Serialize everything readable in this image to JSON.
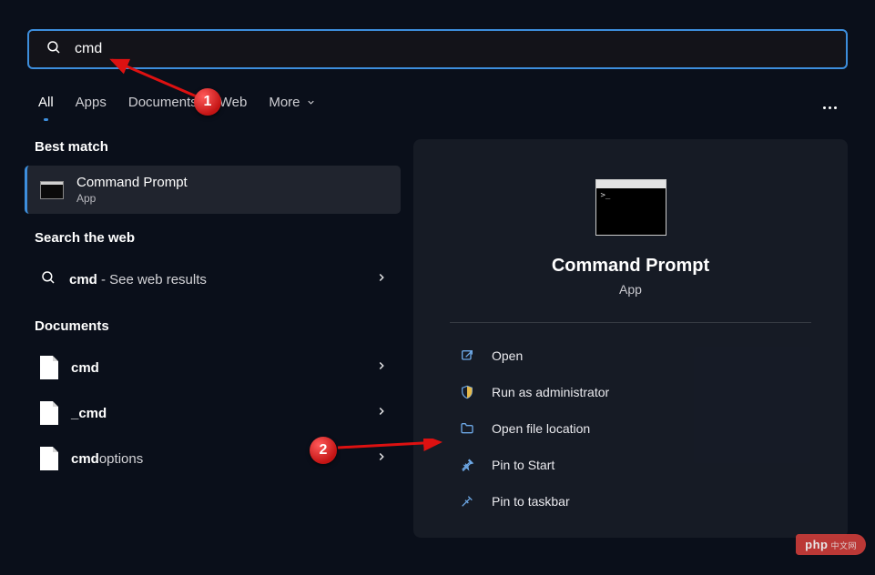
{
  "search": {
    "value": "cmd"
  },
  "filters": {
    "items": [
      {
        "label": "All",
        "active": true
      },
      {
        "label": "Apps",
        "active": false
      },
      {
        "label": "Documents",
        "active": false
      },
      {
        "label": "Web",
        "active": false
      },
      {
        "label": "More",
        "active": false
      }
    ]
  },
  "sections": {
    "best_match": "Best match",
    "search_web": "Search the web",
    "documents": "Documents"
  },
  "best_match": {
    "title": "Command Prompt",
    "subtitle": "App"
  },
  "web_result": {
    "prefix": "cmd",
    "suffix": " - See web results"
  },
  "docs": [
    {
      "name": "cmd",
      "bold_prefix": "cmd",
      "rest": ""
    },
    {
      "name": "_cmd",
      "bold_prefix": "",
      "rest": "_",
      "bold_suffix": "cmd"
    },
    {
      "name": "cmdoptions",
      "bold_prefix": "cmd",
      "rest": "options"
    }
  ],
  "preview": {
    "title": "Command Prompt",
    "subtitle": "App",
    "actions": [
      {
        "id": "open",
        "label": "Open",
        "icon": "open-icon"
      },
      {
        "id": "runas",
        "label": "Run as administrator",
        "icon": "shield-icon"
      },
      {
        "id": "location",
        "label": "Open file location",
        "icon": "folder-icon"
      },
      {
        "id": "pinstart",
        "label": "Pin to Start",
        "icon": "pin-icon"
      },
      {
        "id": "pintaskbar",
        "label": "Pin to taskbar",
        "icon": "pin-icon"
      }
    ]
  },
  "annotations": {
    "n1": "1",
    "n2": "2"
  },
  "watermark": {
    "text": "php",
    "sub": "中文网"
  }
}
